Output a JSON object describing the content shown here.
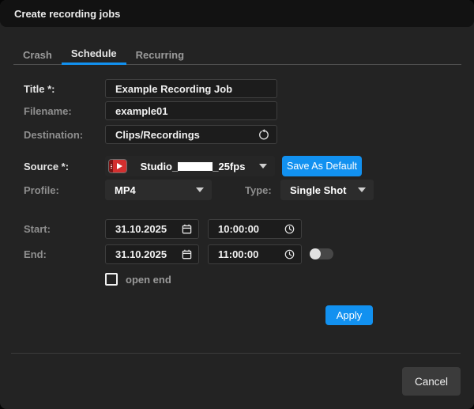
{
  "window": {
    "title": "Create recording jobs"
  },
  "tabs": [
    {
      "label": "Crash",
      "active": false
    },
    {
      "label": "Schedule",
      "active": true
    },
    {
      "label": "Recurring",
      "active": false
    }
  ],
  "form": {
    "title": {
      "label": "Title *:",
      "value": "Example Recording Job"
    },
    "filename": {
      "label": "Filename:",
      "value": "example01"
    },
    "destination": {
      "label": "Destination:",
      "value": "Clips/Recordings",
      "icon": "history-icon"
    },
    "source": {
      "label": "Source *:",
      "value_prefix": "Studio_",
      "value_suffix": "_25fps",
      "redacted": true,
      "icon": "video-source-icon"
    },
    "save_as_default_label": "Save As Default",
    "profile": {
      "label": "Profile:",
      "value": "MP4"
    },
    "type": {
      "label": "Type:",
      "value": "Single Shot"
    },
    "start": {
      "label": "Start:",
      "date": "31.10.2025",
      "time": "10:00:00"
    },
    "end": {
      "label": "End:",
      "date": "31.10.2025",
      "time": "11:00:00"
    },
    "end_toggle": {
      "state": "off"
    },
    "open_end": {
      "label": "open end",
      "checked": false
    },
    "apply_label": "Apply"
  },
  "footer": {
    "cancel_label": "Cancel"
  },
  "colors": {
    "accent": "#1291f0",
    "titlebar_bg": "#121212",
    "body_bg": "#232323",
    "input_bg": "#1c1c1c",
    "input_border": "#3e3e3e",
    "dropdown_bg": "#2c2c2c",
    "cancel_bg": "#3b3b3b",
    "source_red": "#d32f2f"
  }
}
